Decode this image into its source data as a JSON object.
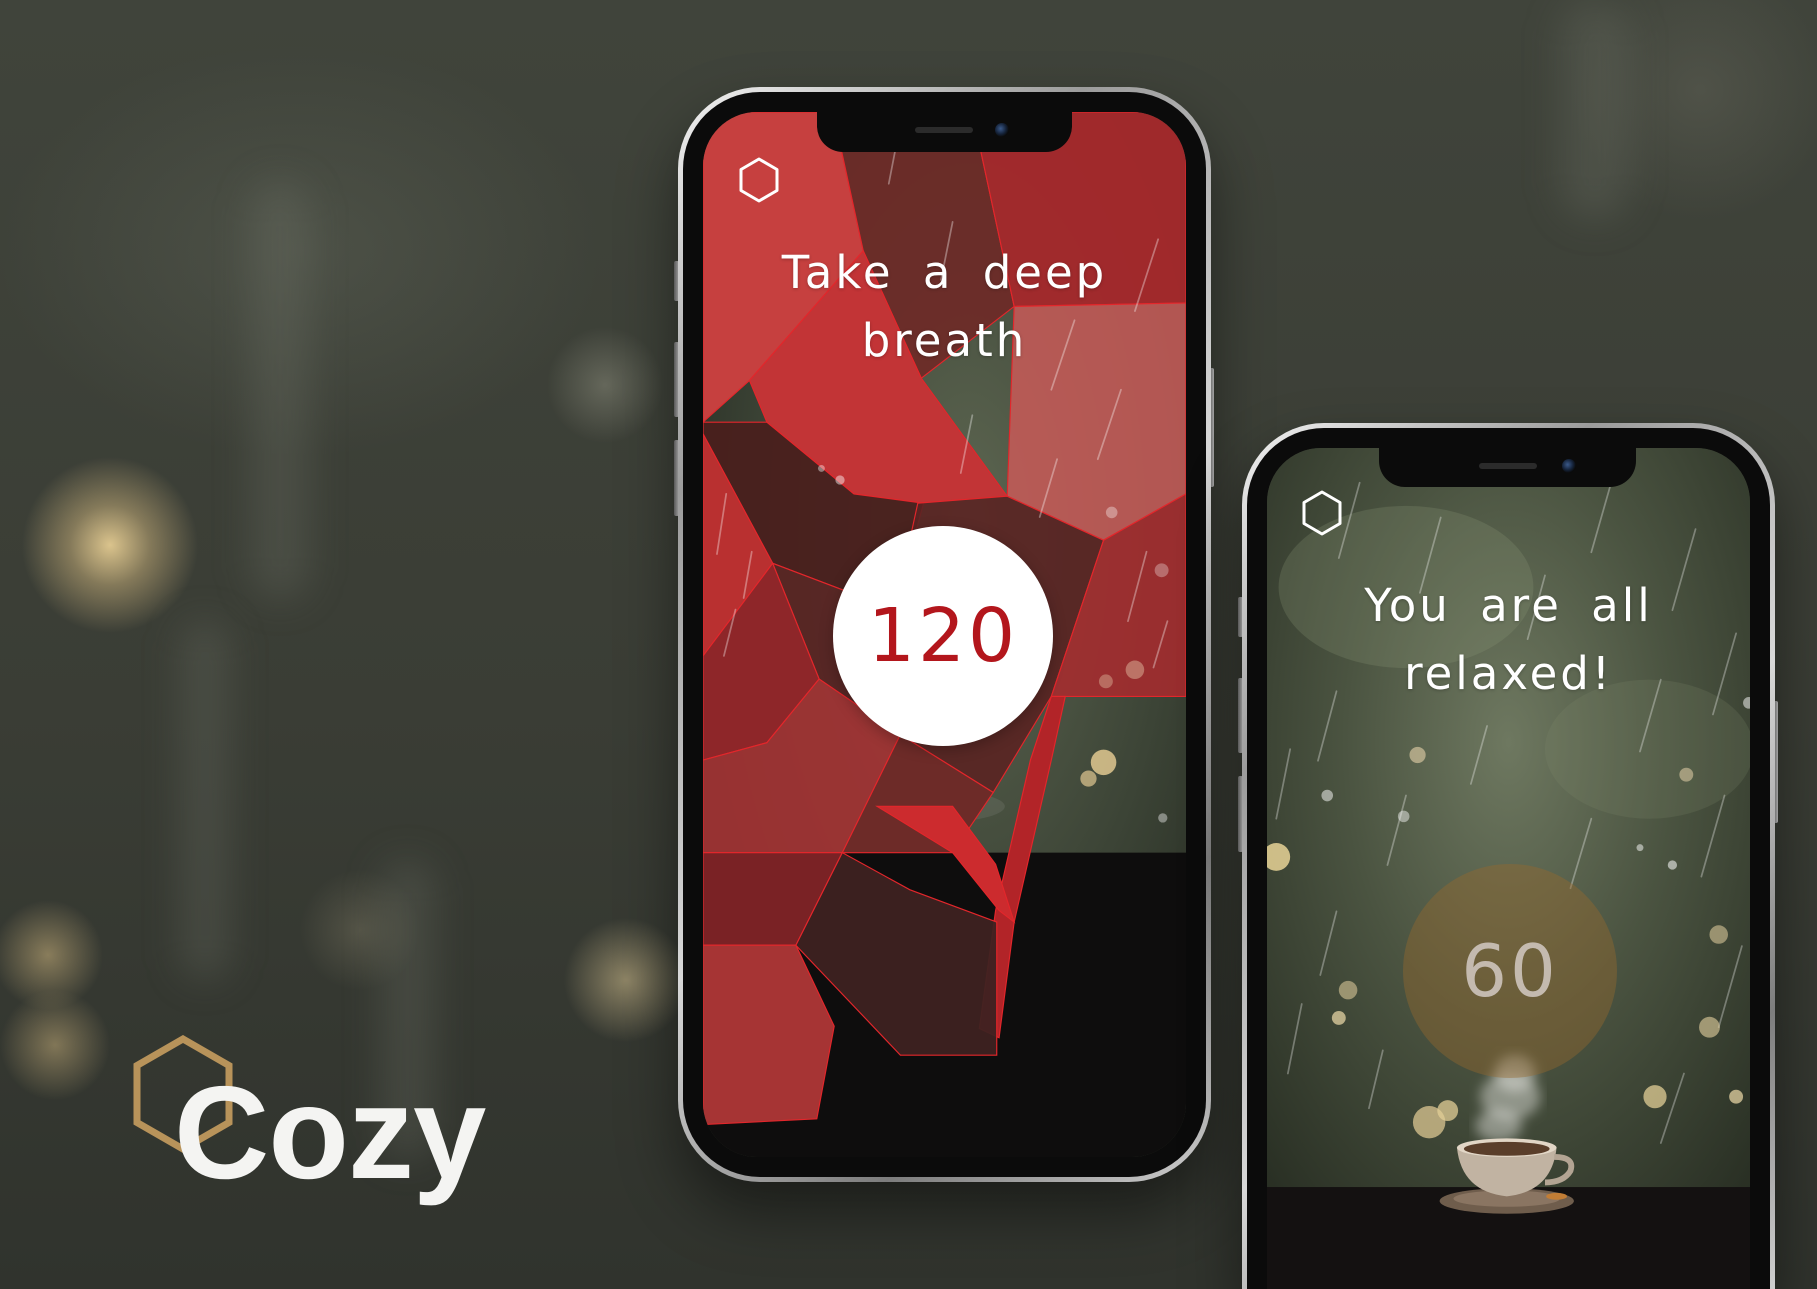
{
  "brand": {
    "name": "Cozy",
    "logo_icon": "hexagon-icon",
    "logo_color": "#b8935a"
  },
  "phones": [
    {
      "menu_icon": "hexagon-icon",
      "title_lines": [
        "Take a deep",
        "breath"
      ],
      "counter": "120",
      "counter_color": "#b3161c",
      "accent": "#c0272d"
    },
    {
      "menu_icon": "hexagon-icon",
      "title_lines": [
        "You are all",
        "relaxed!"
      ],
      "counter": "60",
      "counter_color": "#c4baaf"
    }
  ]
}
